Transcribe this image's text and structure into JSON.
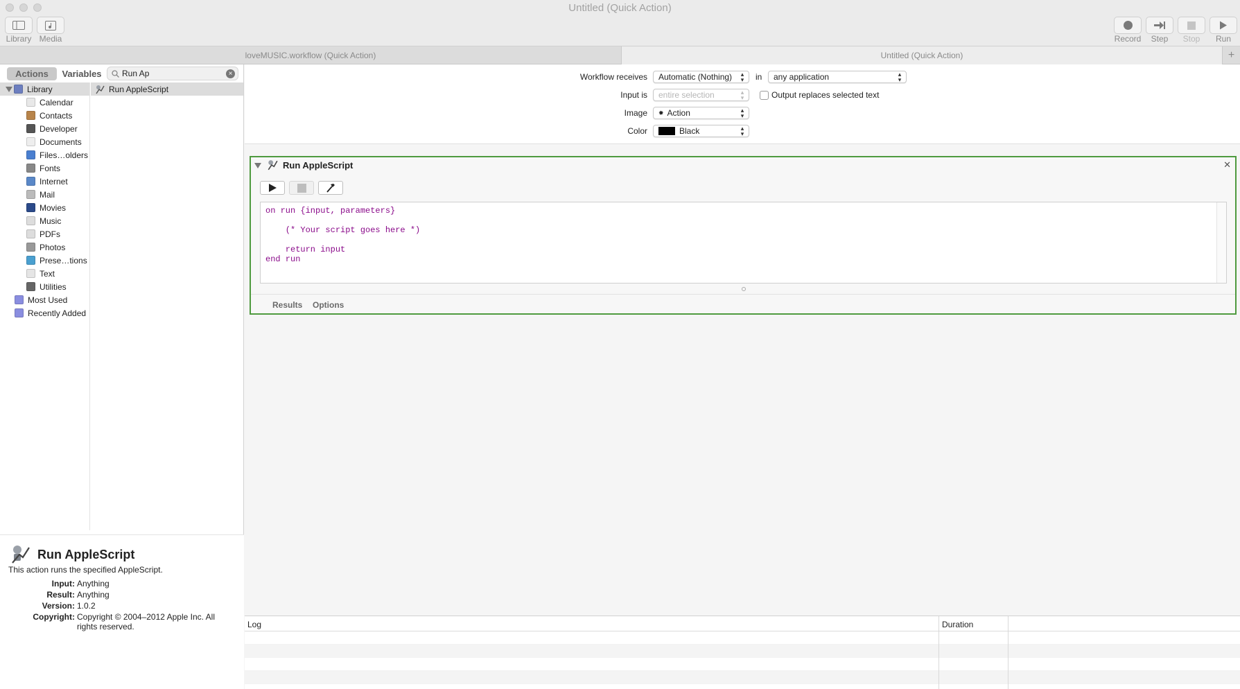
{
  "window": {
    "title": "Untitled (Quick Action)"
  },
  "toolbar": {
    "library_label": "Library",
    "media_label": "Media",
    "record_label": "Record",
    "step_label": "Step",
    "stop_label": "Stop",
    "run_label": "Run"
  },
  "doc_tabs": [
    {
      "label": "loveMUSIC.workflow (Quick Action)"
    },
    {
      "label": "Untitled (Quick Action)"
    }
  ],
  "left_panel": {
    "actions_tab": "Actions",
    "variables_tab": "Variables",
    "search_value": "Run Ap",
    "library": [
      {
        "label": "Library",
        "icon": "library-icon",
        "color": "#6d7fbf"
      },
      {
        "label": "Calendar",
        "icon": "calendar-icon",
        "color": "#e8e8e8"
      },
      {
        "label": "Contacts",
        "icon": "contacts-icon",
        "color": "#b8844a"
      },
      {
        "label": "Developer",
        "icon": "developer-icon",
        "color": "#555555"
      },
      {
        "label": "Documents",
        "icon": "documents-icon",
        "color": "#eeeeee"
      },
      {
        "label": "Files…olders",
        "icon": "files-folders-icon",
        "color": "#4a7fd0"
      },
      {
        "label": "Fonts",
        "icon": "fonts-icon",
        "color": "#888888"
      },
      {
        "label": "Internet",
        "icon": "internet-icon",
        "color": "#5a88c8"
      },
      {
        "label": "Mail",
        "icon": "mail-icon",
        "color": "#bbbbbb"
      },
      {
        "label": "Movies",
        "icon": "movies-icon",
        "color": "#2b4a8a"
      },
      {
        "label": "Music",
        "icon": "music-icon",
        "color": "#dddddd"
      },
      {
        "label": "PDFs",
        "icon": "pdfs-icon",
        "color": "#dddddd"
      },
      {
        "label": "Photos",
        "icon": "photos-icon",
        "color": "#999999"
      },
      {
        "label": "Prese…tions",
        "icon": "presentations-icon",
        "color": "#4aa0d0"
      },
      {
        "label": "Text",
        "icon": "text-icon",
        "color": "#e5e5e5"
      },
      {
        "label": "Utilities",
        "icon": "utilities-icon",
        "color": "#666666"
      },
      {
        "label": "Most Used",
        "icon": "most-used-icon",
        "color": "#8a8ee0"
      },
      {
        "label": "Recently Added",
        "icon": "recently-added-icon",
        "color": "#8a8ee0"
      }
    ],
    "results": [
      {
        "label": "Run AppleScript"
      }
    ],
    "description": {
      "title": "Run AppleScript",
      "text": "This action runs the specified AppleScript.",
      "input_key": "Input:",
      "input_value": "Anything",
      "result_key": "Result:",
      "result_value": "Anything",
      "version_key": "Version:",
      "version_value": "1.0.2",
      "copyright_key": "Copyright:",
      "copyright_value": "Copyright © 2004–2012 Apple Inc.  All rights reserved."
    }
  },
  "workflow": {
    "receives_label": "Workflow receives",
    "receives_value": "Automatic (Nothing)",
    "in_label": "in",
    "application_value": "any application",
    "input_is_label": "Input is",
    "input_is_value": "entire selection",
    "output_replaces_label": "Output replaces selected text",
    "image_label": "Image",
    "image_value": "Action",
    "color_label": "Color",
    "color_value": "Black",
    "color_swatch": "#000000"
  },
  "action": {
    "title": "Run AppleScript",
    "border_color": "#4e9a3e",
    "code": [
      "on run {input, parameters}",
      "",
      "    (* Your script goes here *)",
      "",
      "    return input",
      "end run"
    ],
    "results_tab": "Results",
    "options_tab": "Options"
  },
  "log": {
    "log_header": "Log",
    "duration_header": "Duration"
  }
}
